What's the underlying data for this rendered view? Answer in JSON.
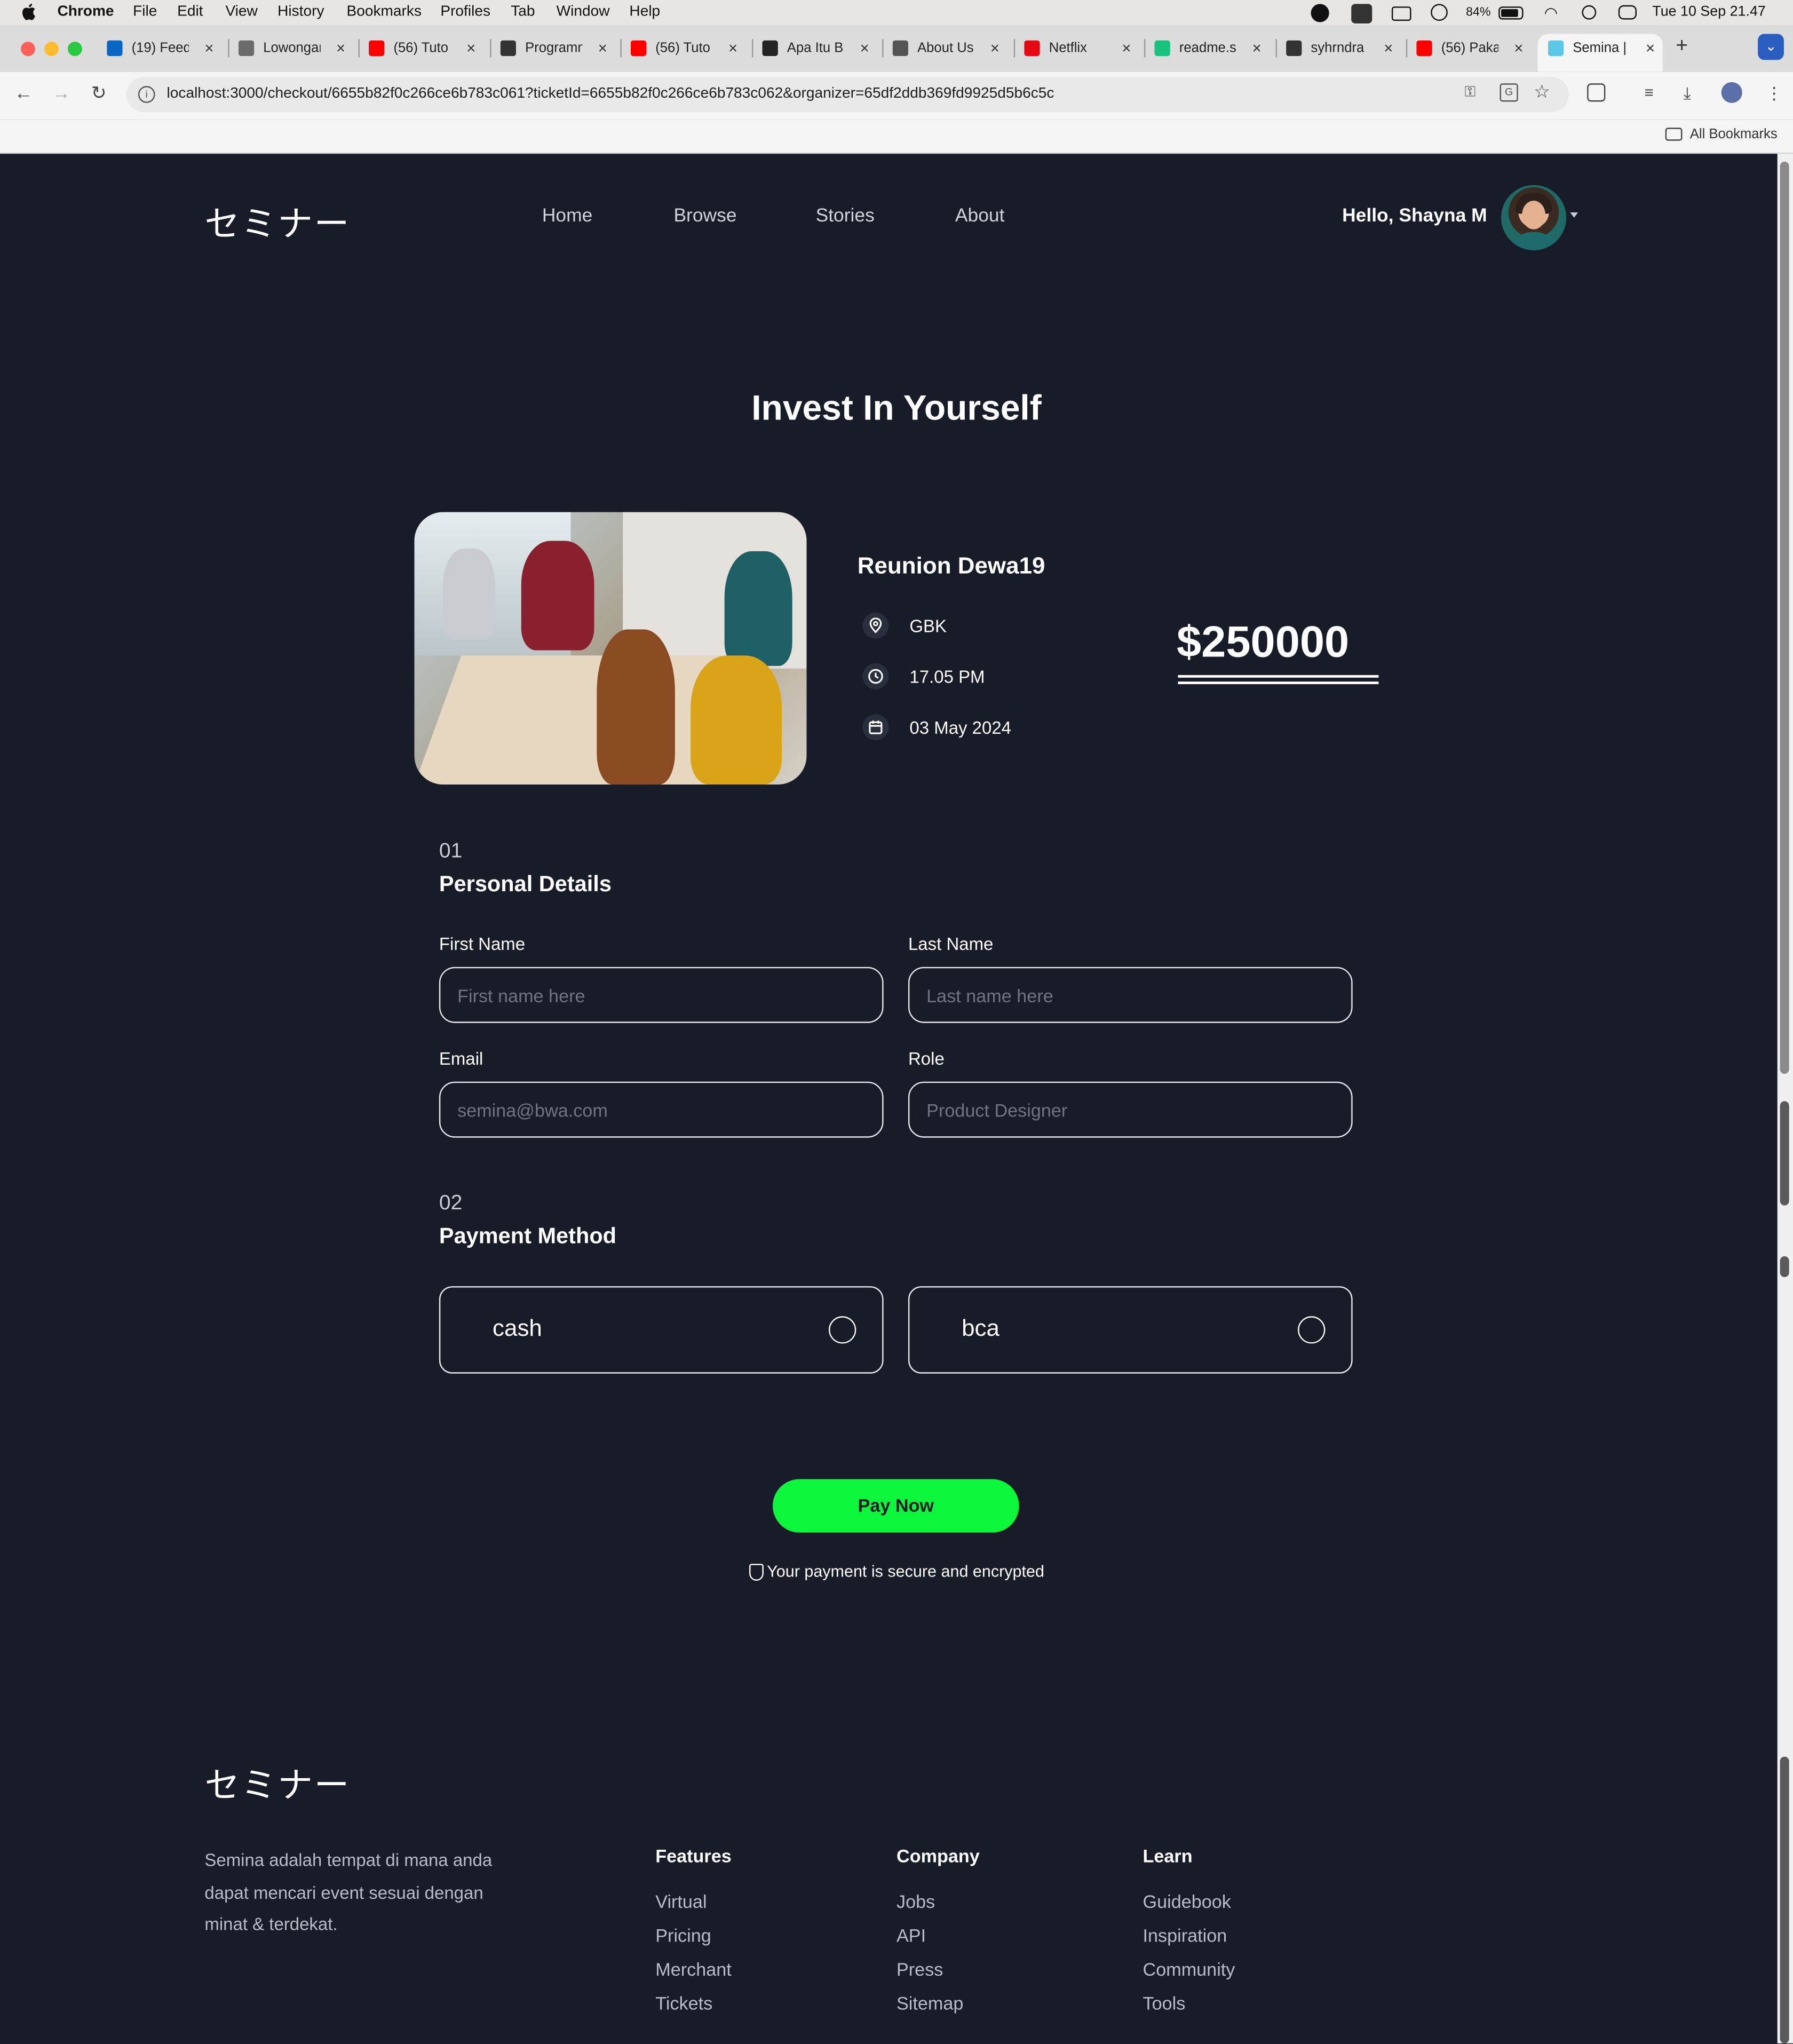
{
  "menubar": {
    "items": [
      "Chrome",
      "File",
      "Edit",
      "View",
      "History",
      "Bookmarks",
      "Profiles",
      "Tab",
      "Window",
      "Help"
    ],
    "battery": "84%",
    "datetime": "Tue 10 Sep  21.47"
  },
  "browser": {
    "tabs": [
      {
        "title": "(19) Feed",
        "color": "#0a66c2"
      },
      {
        "title": "Lowongan",
        "color": "#6b6b6b"
      },
      {
        "title": "(56) Tuto",
        "color": "#ff0000"
      },
      {
        "title": "Programm",
        "color": "#333333"
      },
      {
        "title": "(56) Tuto",
        "color": "#ff0000"
      },
      {
        "title": "Apa Itu B",
        "color": "#222222"
      },
      {
        "title": "About Us",
        "color": "#555555"
      },
      {
        "title": "Netflix",
        "color": "#e50914"
      },
      {
        "title": "readme.s",
        "color": "#19c37d"
      },
      {
        "title": "syhrndra",
        "color": "#333333"
      },
      {
        "title": "(56) Paka",
        "color": "#ff0000"
      },
      {
        "title": "Semina |",
        "color": "#5cc8e8"
      }
    ],
    "url": "localhost:3000/checkout/6655b82f0c266ce6b783c061?ticketId=6655b82f0c266ce6b783c062&organizer=65df2ddb369fd9925d5b6c5c",
    "all_bookmarks": "All Bookmarks"
  },
  "header": {
    "logo": "セミナー",
    "nav": [
      "Home",
      "Browse",
      "Stories",
      "About"
    ],
    "greeting": "Hello, Shayna M"
  },
  "hero": {
    "title": "Invest In Yourself"
  },
  "event": {
    "name": "Reunion Dewa19",
    "venue": "GBK",
    "time": "17.05 PM",
    "date": "03 May 2024",
    "price": "$250000"
  },
  "personal": {
    "number": "01",
    "title": "Personal Details",
    "first_name": {
      "label": "First Name",
      "placeholder": "First name here"
    },
    "last_name": {
      "label": "Last Name",
      "placeholder": "Last name here"
    },
    "email": {
      "label": "Email",
      "placeholder": "semina@bwa.com"
    },
    "role": {
      "label": "Role",
      "placeholder": "Product Designer"
    }
  },
  "payment": {
    "number": "02",
    "title": "Payment Method",
    "options": [
      "cash",
      "bca"
    ]
  },
  "actions": {
    "pay_now": "Pay Now",
    "secure_note": "Your payment is secure and encrypted"
  },
  "footer": {
    "logo": "セミナー",
    "description": "Semina adalah tempat di mana anda dapat mencari event sesuai dengan minat & terdekat.",
    "columns": [
      {
        "title": "Features",
        "items": [
          "Virtual",
          "Pricing",
          "Merchant",
          "Tickets"
        ]
      },
      {
        "title": "Company",
        "items": [
          "Jobs",
          "API",
          "Press",
          "Sitemap"
        ]
      },
      {
        "title": "Learn",
        "items": [
          "Guidebook",
          "Inspiration",
          "Community",
          "Tools"
        ]
      }
    ]
  },
  "colors": {
    "page_bg": "#181c29",
    "accent": "#0cf73b"
  }
}
